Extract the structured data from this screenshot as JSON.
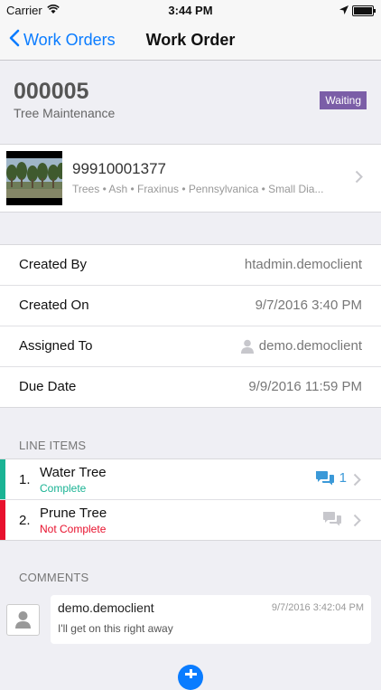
{
  "status_bar": {
    "carrier": "Carrier",
    "time": "3:44 PM"
  },
  "nav": {
    "back_label": "Work Orders",
    "title": "Work Order"
  },
  "order": {
    "number": "000005",
    "type": "Tree Maintenance",
    "status": "Waiting",
    "status_color": "#7b5ea7"
  },
  "asset": {
    "id": "99910001377",
    "description": "Trees • Ash • Fraxinus • Pennsylvanica • Small Dia..."
  },
  "details": [
    {
      "label": "Created By",
      "value": "htadmin.democlient"
    },
    {
      "label": "Created On",
      "value": "9/7/2016 3:40 PM"
    },
    {
      "label": "Assigned To",
      "value": "demo.democlient"
    },
    {
      "label": "Due Date",
      "value": "9/9/2016 11:59 PM"
    }
  ],
  "line_items_header": "LINE ITEMS",
  "line_items": [
    {
      "num": "1.",
      "name": "Water Tree",
      "status": "Complete",
      "status_color": "#1ab394",
      "comment_count": "1",
      "comment_icon": "chat-bubbles-icon"
    },
    {
      "num": "2.",
      "name": "Prune Tree",
      "status": "Not Complete",
      "status_color": "#e8112d",
      "comment_count": "",
      "comment_icon": "chat-bubbles-icon"
    }
  ],
  "comments_header": "COMMENTS",
  "comments": [
    {
      "author": "demo.democlient",
      "time": "9/7/2016 3:42:04 PM",
      "text": "I'll get on this right away"
    }
  ],
  "colors": {
    "accent": "#0a7cff",
    "background": "#efeff4"
  }
}
